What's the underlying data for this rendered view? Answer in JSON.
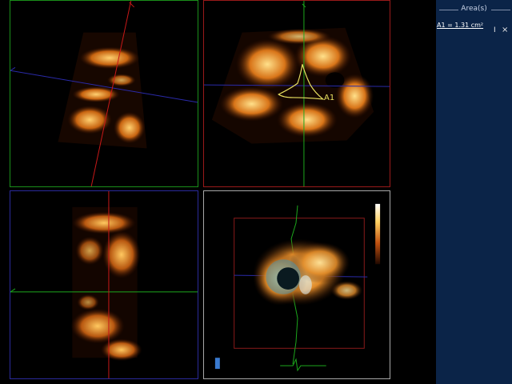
{
  "panel": {
    "title": "Area(s)",
    "measurements": [
      {
        "label": "A1 = 1.31 cm²",
        "delete_icon": "close-icon",
        "cursor_icon": "text-cursor-icon"
      }
    ]
  },
  "viewports": {
    "top_right": {
      "annotation": "A1"
    }
  },
  "colors": {
    "green_plane": "#1a8f1a",
    "red_plane": "#b01818",
    "blue_plane": "#2a2aa8",
    "trace": "#e8e060",
    "panel_bg": "#0b2448"
  },
  "colorbar": {
    "icon": "colorbar-icon"
  },
  "orientation_marker": {
    "icon": "cube-orientation-icon"
  }
}
